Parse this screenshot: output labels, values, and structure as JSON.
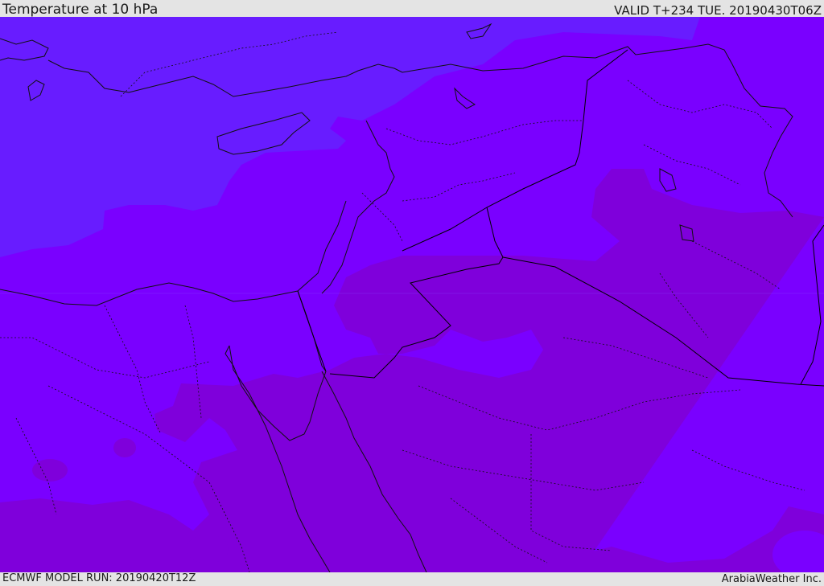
{
  "header": {
    "title": "Temperature at 10 hPa",
    "valid": "VALID T+234 TUE. 20190430T06Z"
  },
  "footer": {
    "model_run": "ECMWF MODEL RUN: 20190420T12Z",
    "credit": "ArabiaWeather Inc."
  },
  "map": {
    "variable": "Temperature",
    "level": "10 hPa",
    "fill_colors": {
      "colder": "#681cff",
      "mid": "#7a00ff",
      "warmer": "#7f00db"
    },
    "boundary_color": "#000000"
  }
}
